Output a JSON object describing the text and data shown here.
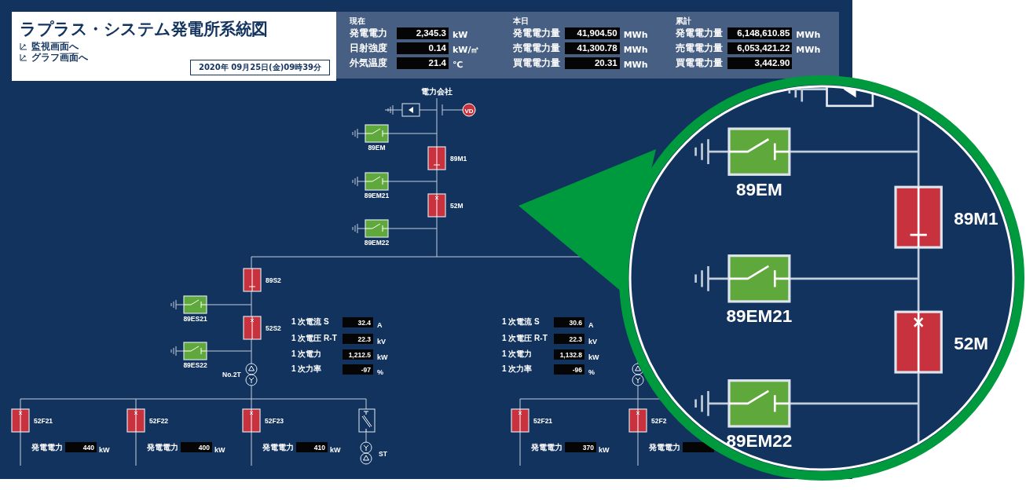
{
  "header": {
    "title": "ラプラス・システム発電所系統図",
    "links": [
      "監視画面へ",
      "グラフ画面へ"
    ],
    "datetime": "2020年 09月25日(金)09時39分"
  },
  "stats": [
    {
      "heading": "現在",
      "rows": [
        {
          "label": "発電電力",
          "value": "2,345.3",
          "unit": "kW"
        },
        {
          "label": "日射強度",
          "value": "0.14",
          "unit": "kW/㎡"
        },
        {
          "label": "外気温度",
          "value": "21.4",
          "unit": "℃"
        }
      ]
    },
    {
      "heading": "本日",
      "rows": [
        {
          "label": "発電電力量",
          "value": "41,904.50",
          "unit": "MWh"
        },
        {
          "label": "売電電力量",
          "value": "41,300.78",
          "unit": "MWh"
        },
        {
          "label": "買電電力量",
          "value": "20.31",
          "unit": "MWh"
        }
      ]
    },
    {
      "heading": "累計",
      "rows": [
        {
          "label": "発電電力量",
          "value": "6,148,610.85",
          "unit": "MWh"
        },
        {
          "label": "売電電力量",
          "value": "6,053,421.22",
          "unit": "MWh"
        },
        {
          "label": "買電電力量",
          "value": "3,442.90"
        }
      ]
    }
  ],
  "diagram": {
    "source_label": "電力会社",
    "meter_badge": "VD",
    "main_devices": [
      {
        "kind": "earth",
        "label": "89EM",
        "closed": false
      },
      {
        "kind": "disconnector",
        "label": "89M1",
        "closed": true
      },
      {
        "kind": "earth",
        "label": "89EM21",
        "closed": false
      },
      {
        "kind": "breaker",
        "label": "52M",
        "closed": true
      },
      {
        "kind": "earth",
        "label": "89EM22",
        "closed": false
      }
    ],
    "branch_devices": [
      {
        "kind": "disconnector",
        "label": "89S2",
        "closed": true
      },
      {
        "kind": "earth",
        "label": "89ES21",
        "closed": false
      },
      {
        "kind": "breaker",
        "label": "52S2",
        "closed": true
      },
      {
        "kind": "earth",
        "label": "89ES22",
        "closed": false
      }
    ],
    "transformer_label": "No.2T",
    "readings": [
      [
        {
          "label": "1 次電流 S",
          "value": "32.4",
          "unit": "A"
        },
        {
          "label": "1 次電圧 R-T",
          "value": "22.3",
          "unit": "kV"
        },
        {
          "label": "1 次電力",
          "value": "1,212.5",
          "unit": "kW"
        },
        {
          "label": "1 次力率",
          "value": "-97",
          "unit": "%"
        }
      ],
      [
        {
          "label": "1 次電流 S",
          "value": "30.6",
          "unit": "A"
        },
        {
          "label": "1 次電圧 R-T",
          "value": "22.3",
          "unit": "kV"
        },
        {
          "label": "1 次電力",
          "value": "1,132.8",
          "unit": "kW"
        },
        {
          "label": "1 次力率",
          "value": "-96",
          "unit": "%"
        }
      ]
    ],
    "feeders": [
      {
        "label": "52F21",
        "closed": true,
        "reading_label": "発電電力",
        "value": "440",
        "unit": "kW"
      },
      {
        "label": "52F22",
        "closed": true,
        "reading_label": "発電電力",
        "value": "400",
        "unit": "kW"
      },
      {
        "label": "52F23",
        "closed": true,
        "reading_label": "発電電力",
        "value": "410",
        "unit": "kW"
      }
    ],
    "station_transformer_label": "ST",
    "right_feeders": [
      {
        "label": "52F21",
        "closed": true,
        "reading_label": "発電電力",
        "value": "370",
        "unit": "kW"
      },
      {
        "label": "52F2",
        "closed": true,
        "reading_label": "発電電力"
      }
    ]
  },
  "magnifier": {
    "devices": [
      {
        "kind": "earth",
        "label": "89EM",
        "closed": false
      },
      {
        "kind": "disconnector",
        "label": "89M1",
        "closed": true
      },
      {
        "kind": "earth",
        "label": "89EM21",
        "closed": false
      },
      {
        "kind": "breaker",
        "label": "52M",
        "closed": true
      },
      {
        "kind": "earth",
        "label": "89EM22",
        "closed": false
      }
    ]
  }
}
